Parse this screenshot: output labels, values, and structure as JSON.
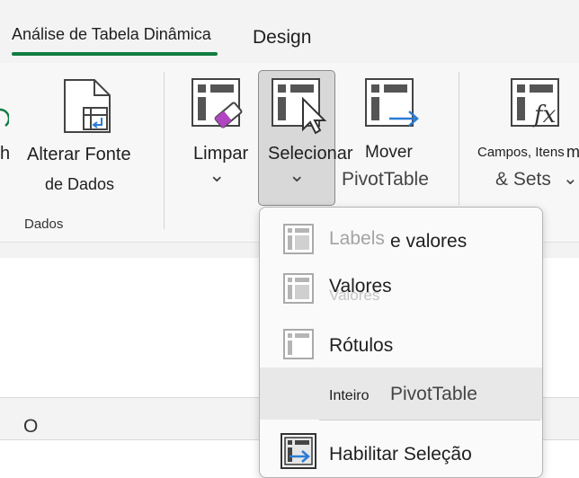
{
  "colors": {
    "accent": "#107c41",
    "magenta": "#b146c2",
    "blue": "#2b7cd3"
  },
  "tabs": [
    {
      "label": "Análise de Tabela Dinâmica",
      "active": true
    },
    {
      "label": "Design",
      "active": false
    }
  ],
  "ribbon": {
    "refresh_partial": "h",
    "change_source": {
      "line1": "Alterar Fonte",
      "line2": "de Dados"
    },
    "group_label": "Dados",
    "clear": {
      "label": "Limpar",
      "chevron": "⌄"
    },
    "select": {
      "label": "Selecionar",
      "chevron": "⌄"
    },
    "move": {
      "line1": "Mover",
      "line2": "PivotTable"
    },
    "fields": {
      "line1": "Campos, Itens",
      "line2": "& Sets",
      "chevron": "⌄",
      "cut_text": "m"
    }
  },
  "sheet": {
    "column_letter": "O"
  },
  "menu": {
    "items": [
      {
        "label_ghost": "Labels",
        "label": " e valores",
        "disabled": false
      },
      {
        "label": "Valores",
        "ghost": "Valores"
      },
      {
        "label": "Rótulos"
      },
      {
        "prefix": "Inteiro",
        "label": "PivotTable",
        "underline_char": "T"
      },
      {
        "label": "Habilitar Seleção"
      }
    ]
  }
}
